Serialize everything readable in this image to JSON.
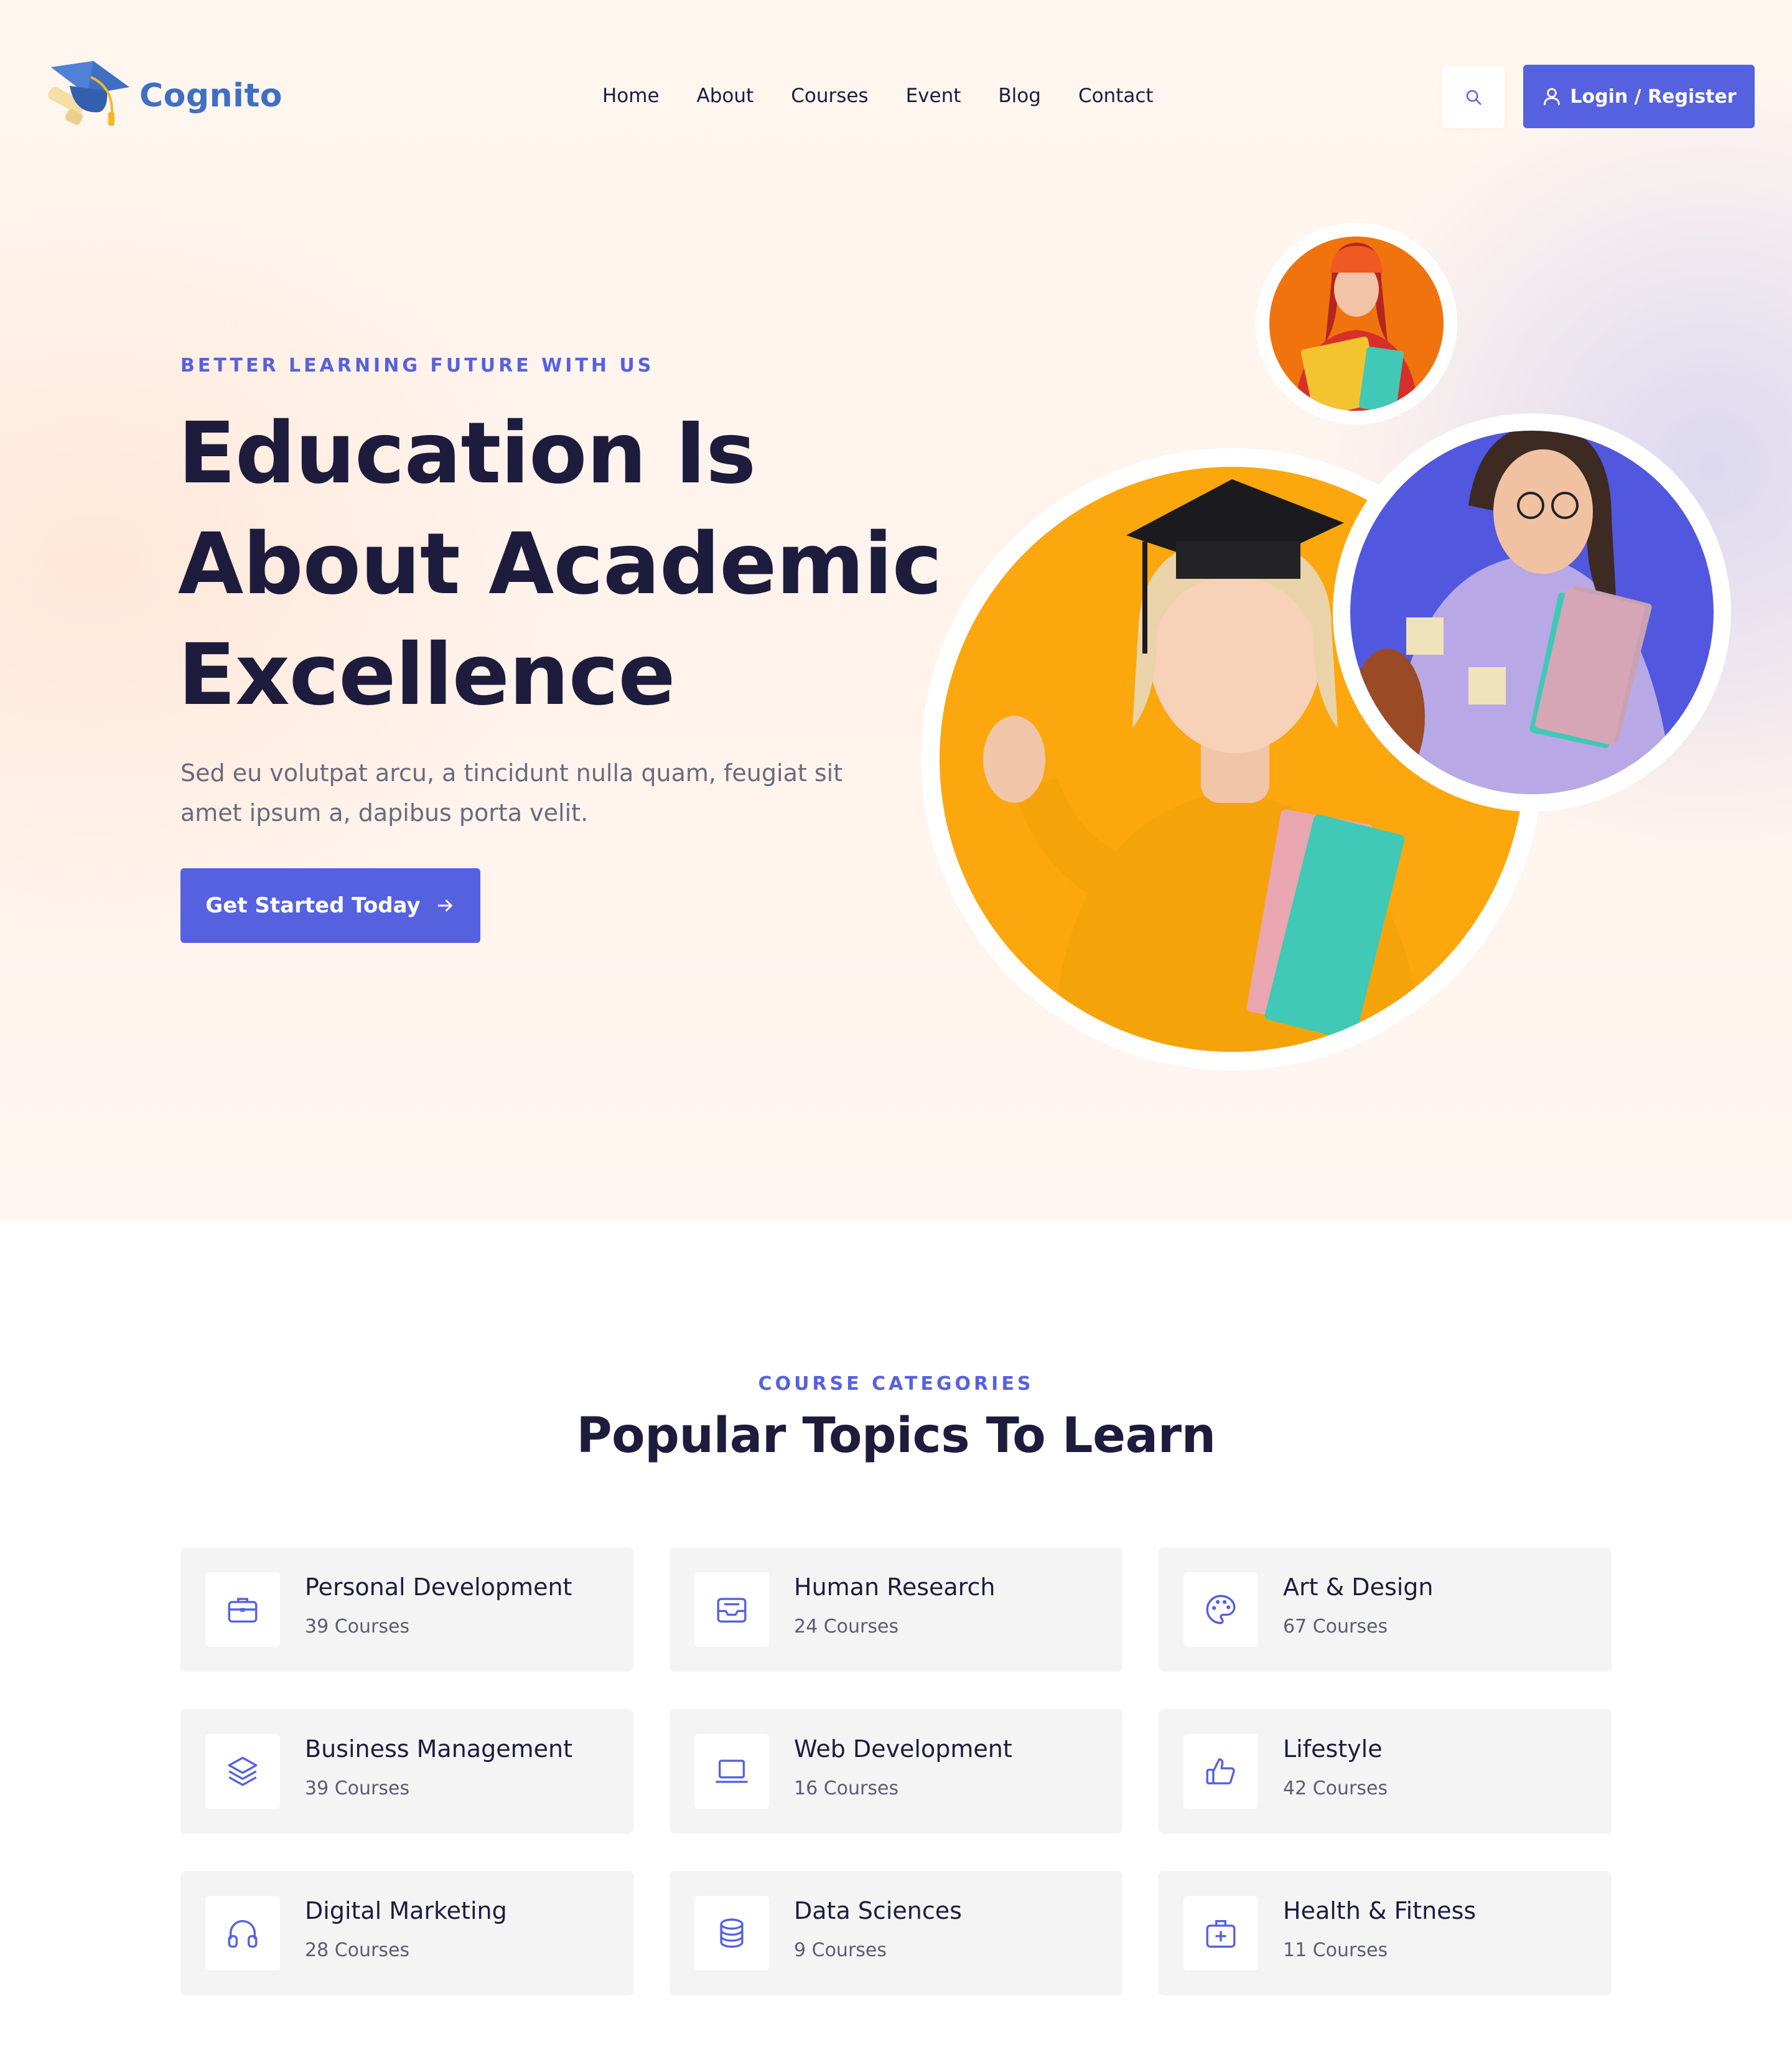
{
  "brand": {
    "name": "Cognito",
    "accent": "#5661e0",
    "logo_color": "#3f6fc2"
  },
  "nav": {
    "items": [
      "Home",
      "About",
      "Courses",
      "Event",
      "Blog",
      "Contact"
    ]
  },
  "header": {
    "search_icon": "search-icon",
    "login_label": "Login / Register",
    "login_icon": "user-icon"
  },
  "hero": {
    "eyebrow": "BETTER LEARNING FUTURE WITH US",
    "headline": [
      "Education Is",
      "About Academic",
      "Excellence"
    ],
    "lead": "Sed eu volutpat arcu, a tincidunt nulla quam, feugiat sit amet ipsum a, dapibus porta velit.",
    "cta_label": "Get Started Today",
    "cta_icon": "arrow-right-icon"
  },
  "categories": {
    "eyebrow": "COURSE CATEGORIES",
    "title": "Popular Topics To Learn",
    "items": [
      {
        "title": "Personal Development",
        "count": "39 Courses",
        "icon": "briefcase-icon"
      },
      {
        "title": "Human Research",
        "count": "24 Courses",
        "icon": "inbox-icon"
      },
      {
        "title": "Art & Design",
        "count": "67 Courses",
        "icon": "palette-icon"
      },
      {
        "title": "Business Management",
        "count": "39 Courses",
        "icon": "layers-icon"
      },
      {
        "title": "Web Development",
        "count": "16 Courses",
        "icon": "laptop-icon"
      },
      {
        "title": "Lifestyle",
        "count": "42 Courses",
        "icon": "thumbs-up-icon"
      },
      {
        "title": "Digital Marketing",
        "count": "28 Courses",
        "icon": "headphones-icon"
      },
      {
        "title": "Data Sciences",
        "count": "9 Courses",
        "icon": "database-icon"
      },
      {
        "title": "Health & Fitness",
        "count": "11 Courses",
        "icon": "first-aid-kit-icon"
      }
    ]
  }
}
